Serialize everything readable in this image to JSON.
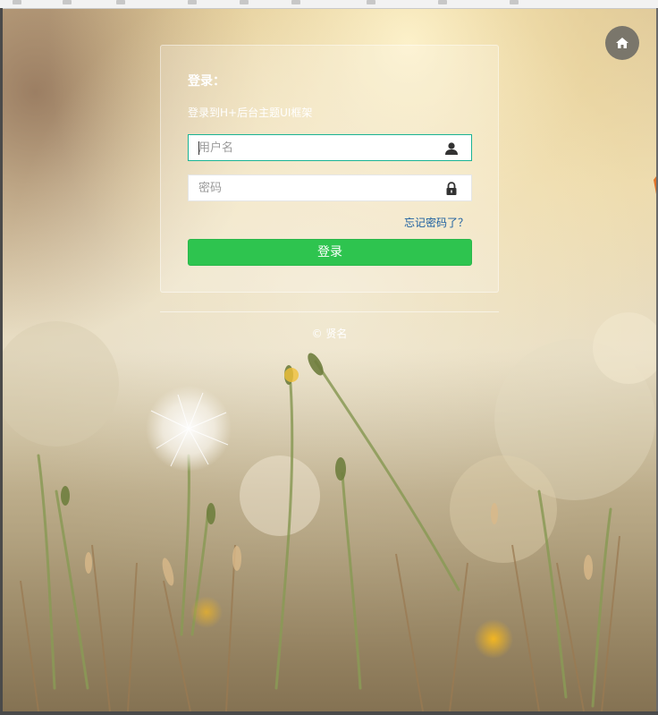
{
  "login": {
    "title": "登录：",
    "subtitle": "登录到H+后台主题UI框架",
    "username_placeholder": "用户名",
    "password_placeholder": "密码",
    "forgot_label": "忘记密码了？",
    "submit_label": "登录"
  },
  "footer": {
    "copyright": "© 贤名"
  },
  "icons": {
    "home": "home-icon",
    "user": "user-icon",
    "lock": "lock-icon"
  },
  "colors": {
    "accent_green": "#2ec44f",
    "focus_border": "#1ab394",
    "link_blue": "#1c5fa0",
    "home_button": "#7a766b"
  }
}
